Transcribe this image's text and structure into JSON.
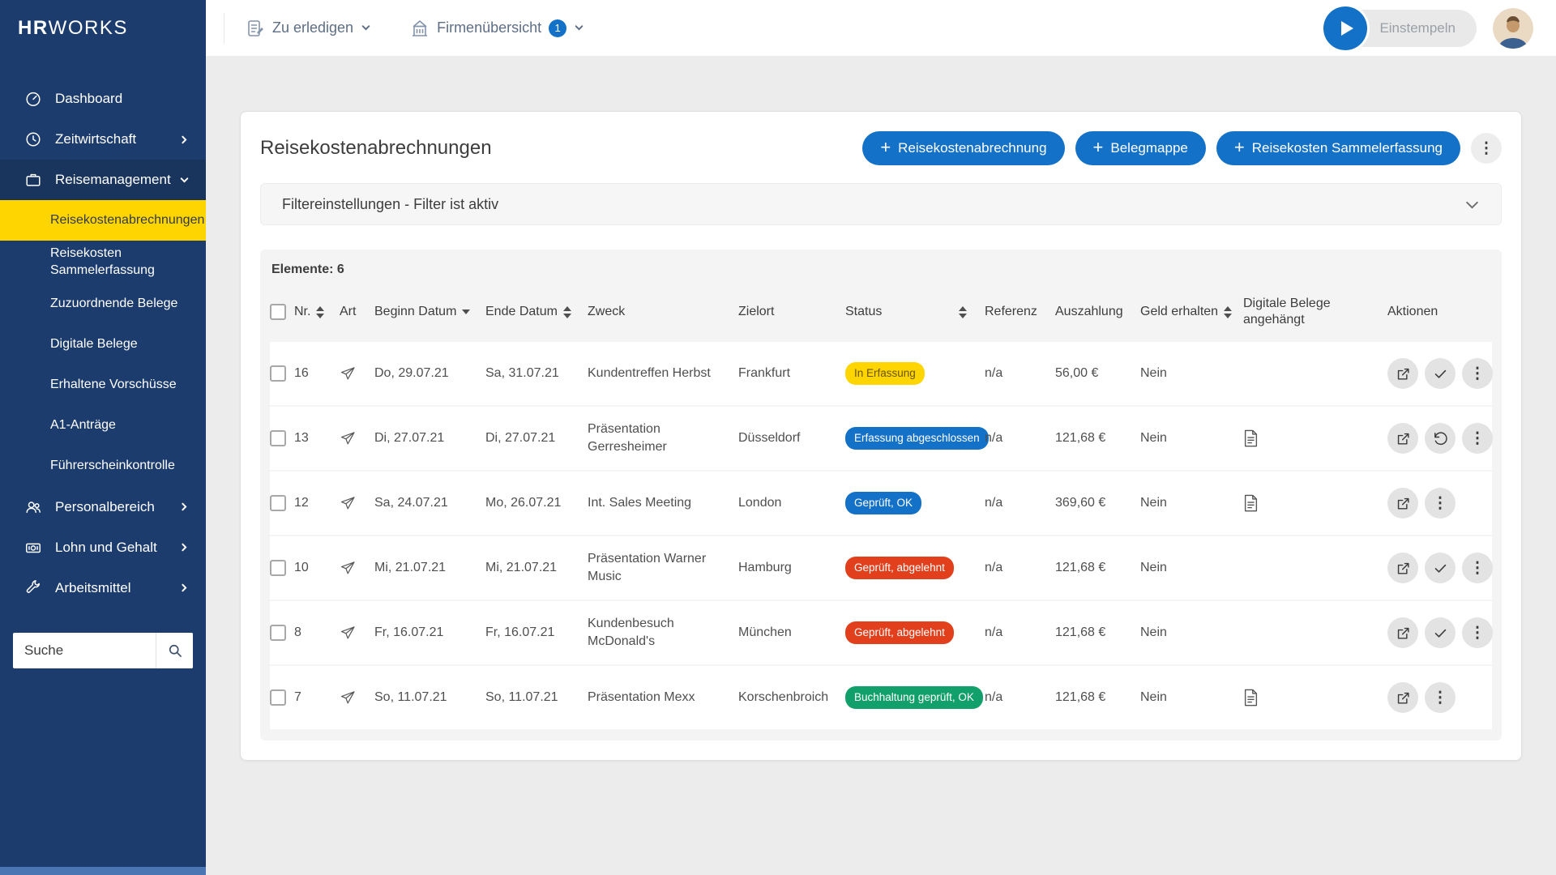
{
  "colors": {
    "sidebar": "#1d3c6e",
    "accent_blue": "#1471c8",
    "active_yellow": "#ffd500",
    "badge_yellow": "#ffd500",
    "badge_yellow_text": "#6a5300",
    "badge_blue": "#1471c8",
    "badge_red": "#e2401c",
    "badge_green": "#11a06b"
  },
  "brand": {
    "bold": "HR",
    "lite": "WORKS"
  },
  "topbar": {
    "todo_label": "Zu erledigen",
    "company_label": "Firmenübersicht",
    "company_badge": "1",
    "clockin_label": "Einstempeln"
  },
  "sidebar": {
    "items": [
      {
        "label": "Dashboard",
        "icon": "dashboard-icon"
      },
      {
        "label": "Zeitwirtschaft",
        "icon": "clock-icon",
        "chevron": "right"
      },
      {
        "label": "Reisemanagement",
        "icon": "briefcase-icon",
        "chevron": "down",
        "expanded": true
      },
      {
        "label": "Personalbereich",
        "icon": "users-icon",
        "chevron": "right"
      },
      {
        "label": "Lohn und Gehalt",
        "icon": "money-icon",
        "chevron": "right"
      },
      {
        "label": "Arbeitsmittel",
        "icon": "tools-icon",
        "chevron": "right"
      }
    ],
    "travel_subitems": [
      {
        "label": "Reisekostenabrechnungen",
        "active": true
      },
      {
        "label": "Reisekosten Sammelerfassung"
      },
      {
        "label": "Zuzuordnende Belege"
      },
      {
        "label": "Digitale Belege"
      },
      {
        "label": "Erhaltene Vorschüsse"
      },
      {
        "label": "A1-Anträge"
      },
      {
        "label": "Führerscheinkontrolle"
      }
    ],
    "search_placeholder": "Suche"
  },
  "page": {
    "title": "Reisekostenabrechnungen",
    "action_buttons": [
      {
        "label": "Reisekostenabrechnung"
      },
      {
        "label": "Belegmappe"
      },
      {
        "label": "Reisekosten Sammelerfassung"
      }
    ],
    "filter_label": "Filtereinstellungen - Filter ist aktiv",
    "elements_label": "Elemente: 6",
    "table": {
      "headers": [
        {
          "label": "Nr.",
          "sort": "both"
        },
        {
          "label": "Art"
        },
        {
          "label": "Beginn Datum",
          "sort": "desc"
        },
        {
          "label": "Ende Datum",
          "sort": "both"
        },
        {
          "label": "Zweck"
        },
        {
          "label": "Zielort"
        },
        {
          "label": "Status",
          "sort": "both"
        },
        {
          "label": "Referenz"
        },
        {
          "label": "Auszahlung"
        },
        {
          "label": "Geld erhalten",
          "sort": "both"
        },
        {
          "label": "Digitale Belege angehängt"
        },
        {
          "label": "Aktionen"
        }
      ],
      "rows": [
        {
          "nr": "16",
          "art": "paper-plane",
          "begin": "Do, 29.07.21",
          "end": "Sa, 31.07.21",
          "zweck": "Kundentreffen Herbst",
          "zielort": "Frankfurt",
          "status": {
            "label": "In Erfassung",
            "type": "yellow"
          },
          "referenz": "n/a",
          "auszahlung": "56,00 €",
          "geld_erhalten": "Nein",
          "beleg": false,
          "actions": [
            "open",
            "check",
            "more"
          ]
        },
        {
          "nr": "13",
          "art": "paper-plane",
          "begin": "Di, 27.07.21",
          "end": "Di, 27.07.21",
          "zweck": "Präsentation Gerresheimer",
          "zielort": "Düsseldorf",
          "status": {
            "label": "Erfassung abgeschlossen",
            "type": "blue"
          },
          "referenz": "n/a",
          "auszahlung": "121,68 €",
          "geld_erhalten": "Nein",
          "beleg": true,
          "actions": [
            "open",
            "undo",
            "more"
          ]
        },
        {
          "nr": "12",
          "art": "paper-plane",
          "begin": "Sa, 24.07.21",
          "end": "Mo, 26.07.21",
          "zweck": "Int. Sales Meeting",
          "zielort": "London",
          "status": {
            "label": "Geprüft, OK",
            "type": "blue"
          },
          "referenz": "n/a",
          "auszahlung": "369,60 €",
          "geld_erhalten": "Nein",
          "beleg": true,
          "actions": [
            "open",
            "more"
          ]
        },
        {
          "nr": "10",
          "art": "paper-plane",
          "begin": "Mi, 21.07.21",
          "end": "Mi, 21.07.21",
          "zweck": "Präsentation Warner Music",
          "zielort": "Hamburg",
          "status": {
            "label": "Geprüft, abgelehnt",
            "type": "red"
          },
          "referenz": "n/a",
          "auszahlung": "121,68 €",
          "geld_erhalten": "Nein",
          "beleg": false,
          "actions": [
            "open",
            "check",
            "more"
          ]
        },
        {
          "nr": "8",
          "art": "paper-plane",
          "begin": "Fr, 16.07.21",
          "end": "Fr, 16.07.21",
          "zweck": "Kundenbesuch McDonald's",
          "zielort": "München",
          "status": {
            "label": "Geprüft, abgelehnt",
            "type": "red"
          },
          "referenz": "n/a",
          "auszahlung": "121,68 €",
          "geld_erhalten": "Nein",
          "beleg": false,
          "actions": [
            "open",
            "check",
            "more"
          ]
        },
        {
          "nr": "7",
          "art": "paper-plane",
          "begin": "So, 11.07.21",
          "end": "So, 11.07.21",
          "zweck": "Präsentation Mexx",
          "zielort": "Korschenbroich",
          "status": {
            "label": "Buchhaltung geprüft, OK",
            "type": "green"
          },
          "referenz": "n/a",
          "auszahlung": "121,68 €",
          "geld_erhalten": "Nein",
          "beleg": true,
          "actions": [
            "open",
            "more"
          ]
        }
      ]
    }
  }
}
